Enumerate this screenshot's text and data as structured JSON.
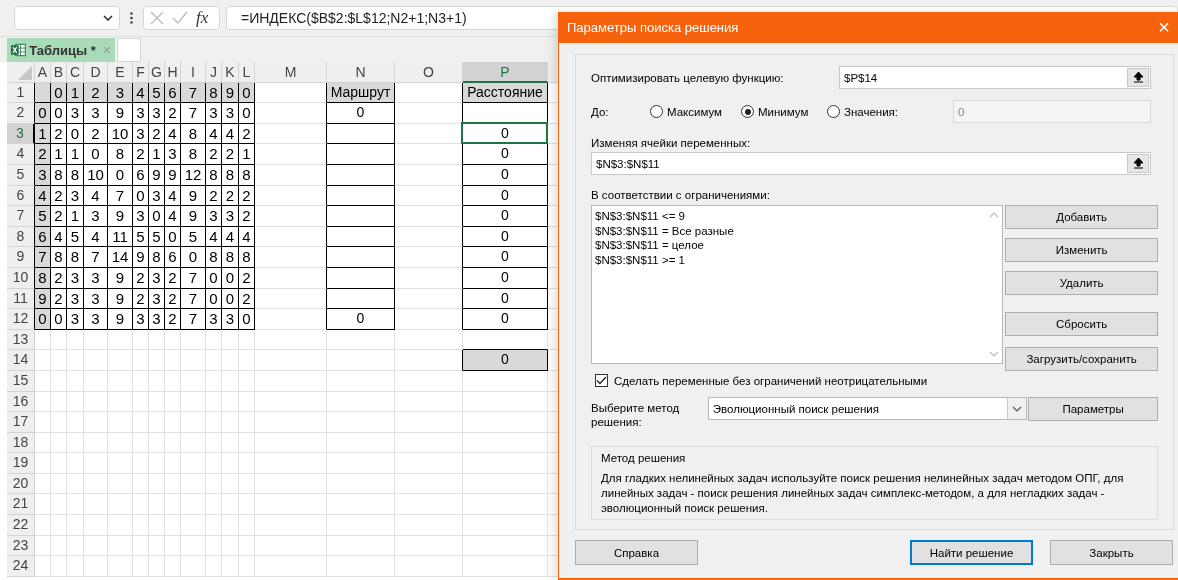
{
  "formula_bar": {
    "function_label": "fx",
    "formula": "=ИНДЕКС($B$2:$L$12;N2+1;N3+1)"
  },
  "sheet_tabs": [
    {
      "label": "Таблицы *",
      "close": "×",
      "selected": true
    }
  ],
  "columns": [
    {
      "label": "A",
      "selected": false
    },
    {
      "label": "B",
      "selected": false
    },
    {
      "label": "C",
      "selected": false
    },
    {
      "label": "D",
      "selected": false
    },
    {
      "label": "E",
      "selected": false
    },
    {
      "label": "F",
      "selected": false
    },
    {
      "label": "G",
      "selected": false
    },
    {
      "label": "H",
      "selected": false
    },
    {
      "label": "I",
      "selected": false
    },
    {
      "label": "J",
      "selected": false
    },
    {
      "label": "K",
      "selected": false
    },
    {
      "label": "L",
      "selected": false
    },
    {
      "label": "M",
      "selected": false
    },
    {
      "label": "N",
      "selected": false
    },
    {
      "label": "O",
      "selected": false
    },
    {
      "label": "P",
      "selected": true
    }
  ],
  "rows": [
    {
      "number": "1",
      "selected": false,
      "cells": [
        null,
        "0",
        "1",
        "2",
        "3",
        "4",
        "5",
        "6",
        "7",
        "8",
        "9",
        "0",
        null,
        "Маршрут",
        null,
        "Расстояние"
      ]
    },
    {
      "number": "2",
      "selected": false,
      "cells": [
        "0",
        "0",
        "3",
        "3",
        "9",
        "3",
        "3",
        "2",
        "7",
        "3",
        "3",
        "0",
        null,
        "0",
        null,
        null
      ]
    },
    {
      "number": "3",
      "selected": true,
      "cells": [
        "1",
        "2",
        "0",
        "2",
        "10",
        "3",
        "2",
        "4",
        "8",
        "4",
        "4",
        "2",
        null,
        null,
        null,
        "0"
      ]
    },
    {
      "number": "4",
      "selected": false,
      "cells": [
        "2",
        "1",
        "1",
        "0",
        "8",
        "2",
        "1",
        "3",
        "8",
        "2",
        "2",
        "1",
        null,
        null,
        null,
        "0"
      ]
    },
    {
      "number": "5",
      "selected": false,
      "cells": [
        "3",
        "8",
        "8",
        "10",
        "0",
        "6",
        "9",
        "9",
        "12",
        "8",
        "8",
        "8",
        null,
        null,
        null,
        "0"
      ]
    },
    {
      "number": "6",
      "selected": false,
      "cells": [
        "4",
        "2",
        "3",
        "4",
        "7",
        "0",
        "3",
        "4",
        "9",
        "2",
        "2",
        "2",
        null,
        null,
        null,
        "0"
      ]
    },
    {
      "number": "7",
      "selected": false,
      "cells": [
        "5",
        "2",
        "1",
        "3",
        "9",
        "3",
        "0",
        "4",
        "9",
        "3",
        "3",
        "2",
        null,
        null,
        null,
        "0"
      ]
    },
    {
      "number": "8",
      "selected": false,
      "cells": [
        "6",
        "4",
        "5",
        "4",
        "11",
        "5",
        "5",
        "0",
        "5",
        "4",
        "4",
        "4",
        null,
        null,
        null,
        "0"
      ]
    },
    {
      "number": "9",
      "selected": false,
      "cells": [
        "7",
        "8",
        "8",
        "7",
        "14",
        "9",
        "8",
        "6",
        "0",
        "8",
        "8",
        "8",
        null,
        null,
        null,
        "0"
      ]
    },
    {
      "number": "10",
      "selected": false,
      "cells": [
        "8",
        "2",
        "3",
        "3",
        "9",
        "2",
        "3",
        "2",
        "7",
        "0",
        "0",
        "2",
        null,
        null,
        null,
        "0"
      ]
    },
    {
      "number": "11",
      "selected": false,
      "cells": [
        "9",
        "2",
        "3",
        "3",
        "9",
        "2",
        "3",
        "2",
        "7",
        "0",
        "0",
        "2",
        null,
        null,
        null,
        "0"
      ]
    },
    {
      "number": "12",
      "selected": false,
      "cells": [
        "0",
        "0",
        "3",
        "3",
        "9",
        "3",
        "3",
        "2",
        "7",
        "3",
        "3",
        "0",
        null,
        "0",
        null,
        "0"
      ]
    },
    {
      "number": "13",
      "selected": false
    },
    {
      "number": "14",
      "selected": false,
      "cells": [
        null,
        null,
        null,
        null,
        null,
        null,
        null,
        null,
        null,
        null,
        null,
        null,
        null,
        null,
        null,
        "0"
      ]
    },
    {
      "number": "15",
      "selected": false
    },
    {
      "number": "16",
      "selected": false
    },
    {
      "number": "17",
      "selected": false
    },
    {
      "number": "18",
      "selected": false
    },
    {
      "number": "19",
      "selected": false
    },
    {
      "number": "20",
      "selected": false
    },
    {
      "number": "21",
      "selected": false
    },
    {
      "number": "22",
      "selected": false
    },
    {
      "number": "23",
      "selected": false
    },
    {
      "number": "24",
      "selected": false
    }
  ],
  "dialog": {
    "title": "Параметры поиска решения",
    "close": "×",
    "objective": {
      "label": "Оптимизировать целевую функцию:",
      "value": "$P$14"
    },
    "to": {
      "label": "До:",
      "options": [
        {
          "label": "Максимум",
          "selected": false
        },
        {
          "label": "Минимум",
          "selected": true
        },
        {
          "label": "Значения:",
          "selected": false
        }
      ],
      "value_field": {
        "value": "0",
        "disabled": true
      }
    },
    "variables": {
      "label": "Изменяя ячейки переменных:",
      "value": "$N$3:$N$11"
    },
    "constraints": {
      "label": "В соответствии с ограничениями:",
      "items": [
        "$N$3:$N$11 <= 9",
        "$N$3:$N$11 = Все разные",
        "$N$3:$N$11 = целое",
        "$N$3:$N$11 >= 1"
      ]
    },
    "constraint_buttons": [
      "Добавить",
      "Изменить",
      "Удалить",
      "Сбросить",
      "Загрузить/сохранить"
    ],
    "nonnegative": {
      "label": "Сделать переменные без ограничений неотрицательными",
      "checked": true
    },
    "method": {
      "label": "Выберите метод решения:",
      "value": "Эволюционный поиск решения",
      "button": "Параметры"
    },
    "description": {
      "title": "Метод решения",
      "text": "Для гладких нелинейных задач используйте поиск решения нелинейных задач методом ОПГ, для линейных задач - поиск решения линейных задач симплекс-методом, а для негладких задач - эволюционный поиск решения."
    },
    "footer_buttons": [
      {
        "label": "Справка",
        "default": false
      },
      {
        "label": "Найти решение",
        "default": true
      },
      {
        "label": "Закрыть",
        "default": false
      }
    ]
  }
}
